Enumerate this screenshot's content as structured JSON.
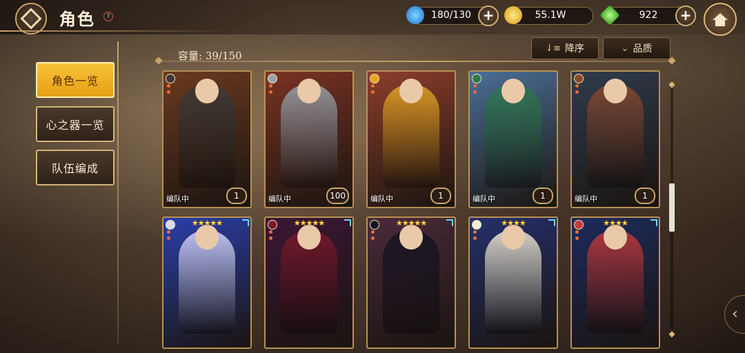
{
  "header": {
    "title": "角色",
    "help_label": "?",
    "back_icon": "back-diamond-icon",
    "home_icon": "home-icon"
  },
  "resources": [
    {
      "name": "stamina",
      "icon": "blue-swirl-icon",
      "value": "180/130",
      "color": "#49b8ff"
    },
    {
      "name": "gold",
      "icon": "gold-coin-icon",
      "value": "55.1W",
      "color": "#f0c23a"
    },
    {
      "name": "gem",
      "icon": "green-crystal-icon",
      "value": "922",
      "color": "#6ad447"
    }
  ],
  "menu": {
    "items": [
      {
        "label": "角色一览",
        "active": true
      },
      {
        "label": "心之器一览",
        "active": false
      },
      {
        "label": "队伍编成",
        "active": false
      }
    ]
  },
  "toolbar": {
    "capacity_label": "容量: 39/150",
    "sort_label": "降序",
    "sort_icon": "sort-descending-icon",
    "filter_label": "品质",
    "filter_icon": "chevron-down-icon"
  },
  "cards": [
    {
      "name": "old-knight-sword",
      "status": "编队中",
      "level": "1",
      "stars": "",
      "theme": "#6b3a1f",
      "accent": "#3a3a3a"
    },
    {
      "name": "armored-knight",
      "status": "编队中",
      "level": "100",
      "stars": "",
      "theme": "#7a3323",
      "accent": "#9aa3ad"
    },
    {
      "name": "caped-warrior",
      "status": "编队中",
      "level": "1",
      "stars": "",
      "theme": "#8c3e2b",
      "accent": "#e6a624"
    },
    {
      "name": "green-hat-girl",
      "status": "编队中",
      "level": "1",
      "stars": "",
      "theme": "#4b6f96",
      "accent": "#2f7a4c"
    },
    {
      "name": "bull-warrior",
      "status": "编队中",
      "level": "1",
      "stars": "",
      "theme": "#2f3b4c",
      "accent": "#8a4a30"
    },
    {
      "name": "silver-hair-ice-mage",
      "status": "",
      "level": "",
      "stars": "★★★★★",
      "theme": "#2a3ea8",
      "accent": "#d8d8ff"
    },
    {
      "name": "jester-villain",
      "status": "",
      "level": "",
      "stars": "★★★★★",
      "theme": "#3b1636",
      "accent": "#7a1a2a"
    },
    {
      "name": "dark-hair-gothic",
      "status": "",
      "level": "",
      "stars": "★★★★★",
      "theme": "#4a2a3a",
      "accent": "#151322"
    },
    {
      "name": "fox-ear-dancer",
      "status": "",
      "level": "",
      "stars": "★★★★",
      "theme": "#25306b",
      "accent": "#f3ecd8"
    },
    {
      "name": "red-hair-lantern",
      "status": "",
      "level": "",
      "stars": "★★★★",
      "theme": "#1d2b5c",
      "accent": "#c43a3a"
    }
  ]
}
